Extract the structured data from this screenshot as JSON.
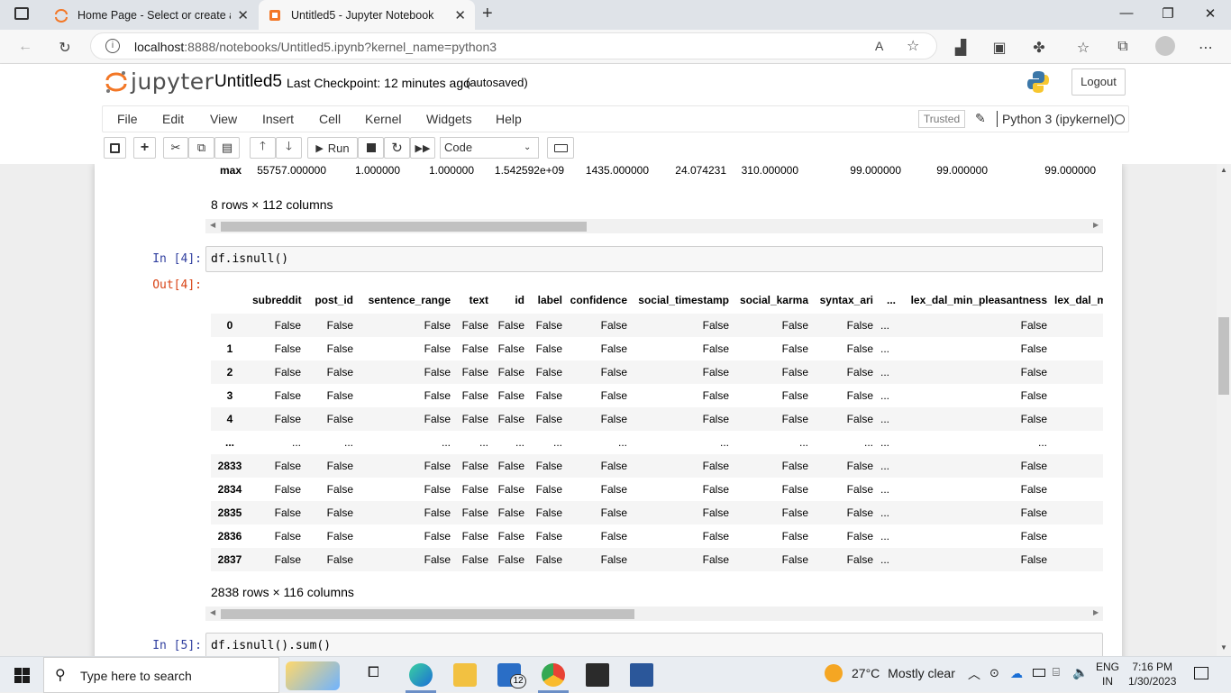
{
  "browser": {
    "tabs": [
      {
        "label": "Home Page - Select or create a n",
        "active": false
      },
      {
        "label": "Untitled5 - Jupyter Notebook",
        "active": true
      }
    ],
    "url_host": "localhost",
    "url_rest": ":8888/notebooks/Untitled5.ipynb?kernel_name=python3",
    "read_aloud_label": "A"
  },
  "jupyter": {
    "logo_text": "jupyter",
    "notebook_name": "Untitled5",
    "checkpoint": "Last Checkpoint: 12 minutes ago",
    "autosave": "(autosaved)",
    "logout_label": "Logout",
    "menu": [
      "File",
      "Edit",
      "View",
      "Insert",
      "Cell",
      "Kernel",
      "Widgets",
      "Help"
    ],
    "trusted_label": "Trusted",
    "kernel_name": "Python 3 (ipykernel)",
    "toolbar": {
      "run_label": "Run",
      "cell_type": "Code"
    }
  },
  "describe_max_row": {
    "label": "max",
    "values": [
      "55757.000000",
      "1.000000",
      "1.000000",
      "1.542592e+09",
      "1435.000000",
      "24.074231",
      "310.000000",
      "99.000000",
      "99.000000",
      "99.000000"
    ]
  },
  "describe_summary": "8 rows × 112 columns",
  "cell4": {
    "in_prompt": "In [4]:",
    "code": "df.isnull()",
    "out_prompt": "Out[4]:",
    "columns": [
      "subreddit",
      "post_id",
      "sentence_range",
      "text",
      "id",
      "label",
      "confidence",
      "social_timestamp",
      "social_karma",
      "syntax_ari",
      "...",
      "lex_dal_min_pleasantness",
      "lex_dal_mi"
    ],
    "rows": [
      {
        "index": "0",
        "values": [
          "False",
          "False",
          "False",
          "False",
          "False",
          "False",
          "False",
          "False",
          "False",
          "False",
          "...",
          "False",
          ""
        ]
      },
      {
        "index": "1",
        "values": [
          "False",
          "False",
          "False",
          "False",
          "False",
          "False",
          "False",
          "False",
          "False",
          "False",
          "...",
          "False",
          ""
        ]
      },
      {
        "index": "2",
        "values": [
          "False",
          "False",
          "False",
          "False",
          "False",
          "False",
          "False",
          "False",
          "False",
          "False",
          "...",
          "False",
          ""
        ]
      },
      {
        "index": "3",
        "values": [
          "False",
          "False",
          "False",
          "False",
          "False",
          "False",
          "False",
          "False",
          "False",
          "False",
          "...",
          "False",
          ""
        ]
      },
      {
        "index": "4",
        "values": [
          "False",
          "False",
          "False",
          "False",
          "False",
          "False",
          "False",
          "False",
          "False",
          "False",
          "...",
          "False",
          ""
        ]
      },
      {
        "index": "...",
        "values": [
          "...",
          "...",
          "...",
          "...",
          "...",
          "...",
          "...",
          "...",
          "...",
          "...",
          "...",
          "...",
          ""
        ]
      },
      {
        "index": "2833",
        "values": [
          "False",
          "False",
          "False",
          "False",
          "False",
          "False",
          "False",
          "False",
          "False",
          "False",
          "...",
          "False",
          ""
        ]
      },
      {
        "index": "2834",
        "values": [
          "False",
          "False",
          "False",
          "False",
          "False",
          "False",
          "False",
          "False",
          "False",
          "False",
          "...",
          "False",
          ""
        ]
      },
      {
        "index": "2835",
        "values": [
          "False",
          "False",
          "False",
          "False",
          "False",
          "False",
          "False",
          "False",
          "False",
          "False",
          "...",
          "False",
          ""
        ]
      },
      {
        "index": "2836",
        "values": [
          "False",
          "False",
          "False",
          "False",
          "False",
          "False",
          "False",
          "False",
          "False",
          "False",
          "...",
          "False",
          ""
        ]
      },
      {
        "index": "2837",
        "values": [
          "False",
          "False",
          "False",
          "False",
          "False",
          "False",
          "False",
          "False",
          "False",
          "False",
          "...",
          "False",
          ""
        ]
      }
    ],
    "summary": "2838 rows × 116 columns"
  },
  "cell5": {
    "in_prompt": "In [5]:",
    "code": "df.isnull().sum()"
  },
  "taskbar": {
    "search_placeholder": "Type here to search",
    "mail_badge": "12",
    "weather_temp": "27°C",
    "weather_desc": "Mostly clear",
    "lang_top": "ENG",
    "lang_bottom": "IN",
    "time": "7:16 PM",
    "date": "1/30/2023"
  },
  "colors": {
    "jupyter_orange": "#f37726",
    "prompt_in": "#303f9f",
    "prompt_out": "#d84315"
  }
}
